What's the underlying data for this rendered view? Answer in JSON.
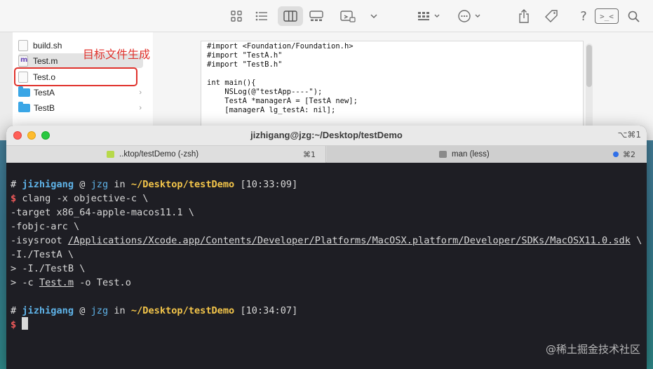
{
  "finder": {
    "files": [
      {
        "name": "build.sh",
        "kind": "file"
      },
      {
        "name": "Test.m",
        "kind": "source"
      },
      {
        "name": "Test.o",
        "kind": "file"
      },
      {
        "name": "TestA",
        "kind": "folder"
      },
      {
        "name": "TestB",
        "kind": "folder"
      }
    ],
    "annotation": "目标文件生成",
    "highlighted_file": "Test.o",
    "toolbar_icons": [
      "icon-view-icon",
      "list-view-icon",
      "column-view-icon",
      "gallery-view-icon",
      "group-icon",
      "chevron-down-icon",
      "grid-group-icon",
      "more-icon",
      "share-icon",
      "tag-icon",
      "help-icon",
      "terminal-icon",
      "search-icon"
    ],
    "toolbar_glyphs": {
      "help": "?",
      "terminal": ">_<"
    },
    "code_preview": [
      "#import <Foundation/Foundation.h>",
      "#import \"TestA.h\"",
      "#import \"TestB.h\"",
      "",
      "int main(){",
      "    NSLog(@\"testApp----\");",
      "    TestA *managerA = [TestA new];",
      "    [managerA lg_testA: nil];"
    ]
  },
  "terminal": {
    "title": "jizhigang@jzg:~/Desktop/testDemo",
    "window_shortcut": "⌥⌘1",
    "tabs": [
      {
        "label": "..ktop/testDemo (-zsh)",
        "shortcut": "⌘1"
      },
      {
        "label": "man (less)",
        "shortcut": "⌘2"
      }
    ],
    "prompt1": {
      "hash": "#",
      "user": "jizhigang",
      "at": "@",
      "host": "jzg",
      "in": "in",
      "path": "~/Desktop/testDemo",
      "time": "[10:33:09]"
    },
    "command_lines": [
      {
        "prefix": "$ ",
        "text": "clang -x objective-c \\"
      },
      {
        "prefix": "",
        "text": "-target x86_64-apple-macos11.1 \\"
      },
      {
        "prefix": "",
        "text": "-fobjc-arc \\"
      },
      {
        "prefix": "",
        "text": "-isysroot "
      },
      {
        "prefix": "",
        "text": "-I./TestA \\"
      },
      {
        "prefix": "> ",
        "text": "-I./TestB \\"
      },
      {
        "prefix": "> ",
        "text": "-c "
      }
    ],
    "sysroot_path": "/Applications/Xcode.app/Contents/Developer/Platforms/MacOSX.platform/Developer/SDKs/MacOSX11.0.sdk",
    "sysroot_tail": " \\",
    "source_file": "Test.m",
    "output_flag": " -o Test.o",
    "prompt2": {
      "hash": "#",
      "user": "jizhigang",
      "at": "@",
      "host": "jzg",
      "in": "in",
      "path": "~/Desktop/testDemo",
      "time": "[10:34:07]"
    },
    "final_prompt": "$"
  },
  "watermark": "@稀土掘金技术社区"
}
